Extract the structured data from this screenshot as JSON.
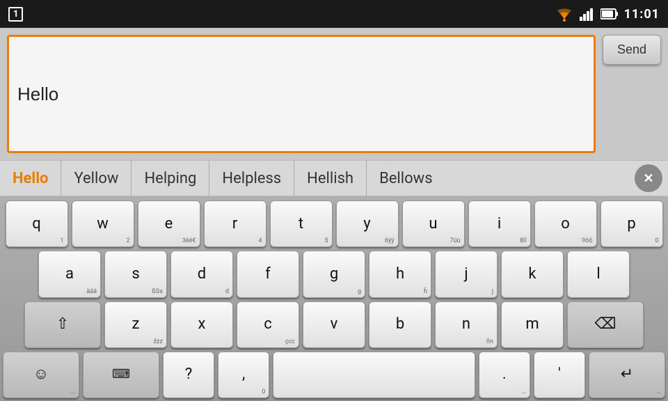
{
  "status_bar": {
    "app_number": "1",
    "time": "11:01"
  },
  "input_area": {
    "text_content": "Hello",
    "send_label": "Send"
  },
  "suggestions": {
    "items": [
      "Hello",
      "Yellow",
      "Helping",
      "Helpless",
      "Hellish",
      "Bellows"
    ],
    "close_label": "×"
  },
  "keyboard": {
    "row1": [
      {
        "main": "q",
        "sub": "1"
      },
      {
        "main": "w",
        "sub": "2"
      },
      {
        "main": "e",
        "sub": "3èé€"
      },
      {
        "main": "r",
        "sub": "4"
      },
      {
        "main": "t",
        "sub": "5"
      },
      {
        "main": "y",
        "sub": "6ÿý"
      },
      {
        "main": "u",
        "sub": "7üù"
      },
      {
        "main": "i",
        "sub": "8îï"
      },
      {
        "main": "o",
        "sub": "9öô"
      },
      {
        "main": "p",
        "sub": "0"
      }
    ],
    "row2": [
      {
        "main": "a",
        "sub": "àâä"
      },
      {
        "main": "s",
        "sub": "ßSs"
      },
      {
        "main": "d",
        "sub": "d"
      },
      {
        "main": "f",
        "sub": ""
      },
      {
        "main": "g",
        "sub": "g"
      },
      {
        "main": "h",
        "sub": "ĥ"
      },
      {
        "main": "j",
        "sub": "j"
      },
      {
        "main": "k",
        "sub": ""
      },
      {
        "main": "l",
        "sub": ""
      }
    ],
    "row3_left": "⇧",
    "row3": [
      {
        "main": "z",
        "sub": "žzz"
      },
      {
        "main": "x",
        "sub": ""
      },
      {
        "main": "c",
        "sub": "çcc"
      },
      {
        "main": "v",
        "sub": ""
      },
      {
        "main": "b",
        "sub": ""
      },
      {
        "main": "n",
        "sub": "ñn"
      },
      {
        "main": "m",
        "sub": ""
      }
    ],
    "row3_right": "⌫",
    "row4": {
      "emoji": "☺",
      "emoji_sub": "...",
      "keyboard": "⌨",
      "keyboard_sub": "",
      "question": "?",
      "question_sub": "",
      "comma": ",",
      "comma_sub": "0",
      "space": " ",
      "period": ".",
      "period_sub": "…",
      "quote": "'",
      "quote_sub": "",
      "enter": "↵",
      "enter_sub": "..."
    }
  }
}
